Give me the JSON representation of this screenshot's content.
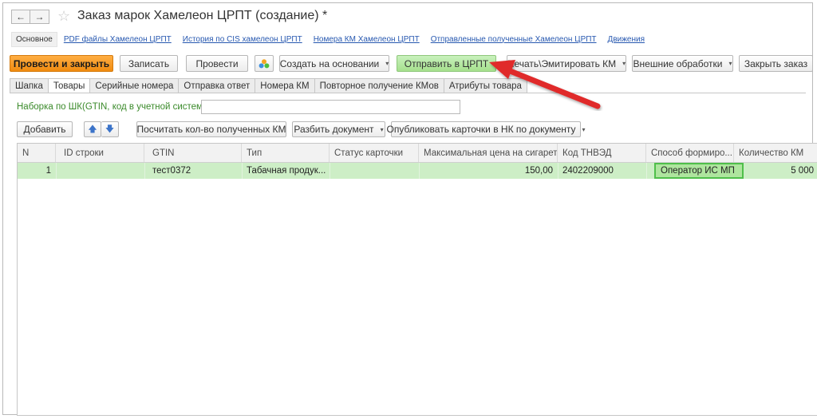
{
  "header": {
    "back_icon": "arrow-left-icon",
    "forward_icon": "arrow-right-icon",
    "star_icon": "star-icon",
    "title": "Заказ марок Хамелеон ЦРПТ (создание) *"
  },
  "links": {
    "active": "Основное",
    "items": [
      "PDF файлы  Хамелеон ЦРПТ",
      "История по CIS хамелеон ЦРПТ",
      "Номера КМ Хамелеон ЦРПТ",
      "Отправленные полученные Хамелеон ЦРПТ",
      "Движения"
    ]
  },
  "toolbar": {
    "post_close": "Провести и закрыть",
    "save": "Записать",
    "post": "Провести",
    "create_based": "Создать на основании",
    "send_crpt": "Отправить в ЦРПТ",
    "print_emit": "Печать\\Эмитировать КМ",
    "external": "Внешние обработки",
    "close_order": "Закрыть заказ",
    "dropdown_glyph": "▾"
  },
  "tabs": [
    "Шапка",
    "Товары",
    "Серийные номера",
    "Отправка ответ",
    "Номера КМ",
    "Повторное получение КМов",
    "Атрибуты товара"
  ],
  "filter": {
    "label": "Наборка по ШК(GTIN, код в учетной системе):",
    "value": ""
  },
  "toolbar2": {
    "add": "Добавить",
    "up_glyph": "🡅",
    "down_glyph": "🡇",
    "count": "Посчитать кол-во полученных КМ",
    "split": "Разбить документ",
    "publish": "Опубликовать карточки в НК по документу"
  },
  "grid": {
    "columns": [
      "N",
      "ID строки",
      "GTIN",
      "Тип",
      "Статус карточки",
      "Максимальная цена на сигареты",
      "Код ТНВЭД",
      "Способ формиро...",
      "Количество КМ"
    ],
    "rows": [
      {
        "n": "1",
        "id": "",
        "gtin": "тест0372",
        "type": "Табачная продук...",
        "status": "",
        "max_price": "150,00",
        "tnved": "2402209000",
        "method": "Оператор ИС МП",
        "qty": "5 000"
      }
    ]
  },
  "colors": {
    "primary_orange": "#f08b10",
    "send_green": "#a5e08d",
    "row_selected": "#cdeec6",
    "link_blue": "#2758b0",
    "annotation_red": "#e02a2a"
  }
}
